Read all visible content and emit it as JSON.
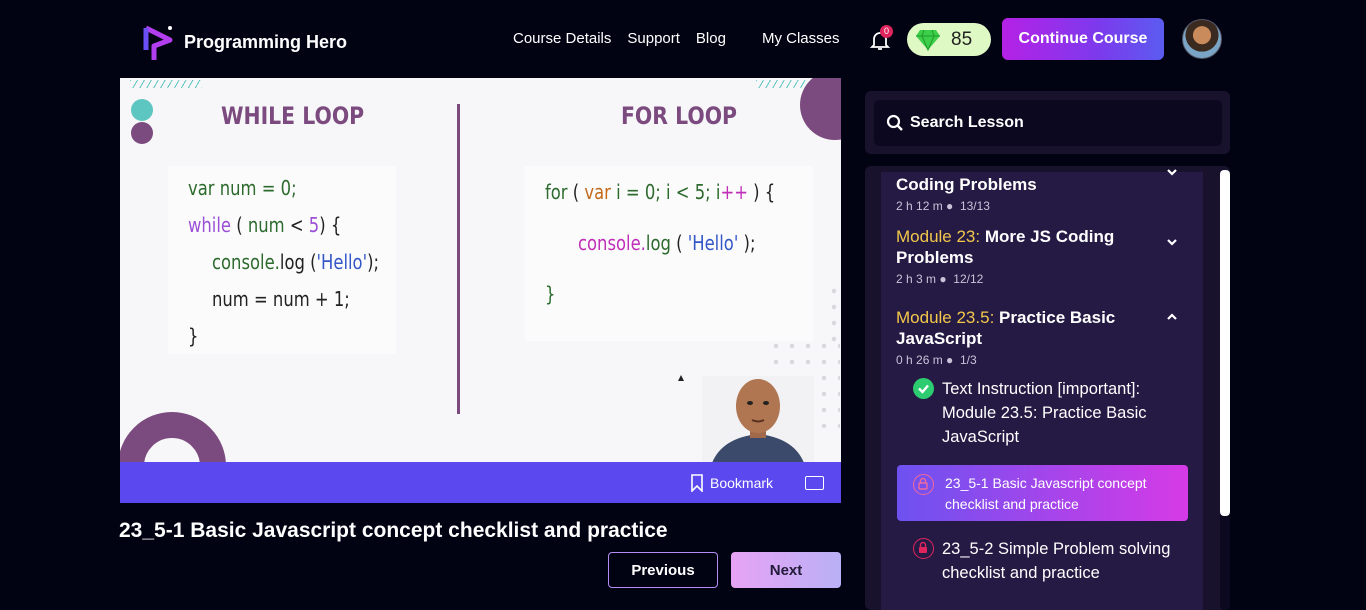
{
  "header": {
    "brand": "Programming Hero",
    "nav": [
      "Course Details",
      "Support",
      "Blog",
      "My Classes"
    ],
    "notification_count": "0",
    "gems": "85",
    "continue_label": "Continue Course"
  },
  "slide": {
    "left_title": "WHILE LOOP",
    "right_title": "FOR LOOP"
  },
  "player": {
    "bookmark_label": "Bookmark"
  },
  "lesson": {
    "title": "23_5-1 Basic Javascript concept checklist and practice",
    "prev_label": "Previous",
    "next_label": "Next"
  },
  "sidebar": {
    "search_placeholder": "Search Lesson",
    "modules": [
      {
        "prefix": "",
        "title": "Coding Problems",
        "duration": "2 h 12 m",
        "progress": "13/13",
        "expanded": false
      },
      {
        "prefix": "Module 23:",
        "title": " More JS Coding Problems",
        "duration": "2 h 3 m",
        "progress": "12/12",
        "expanded": false
      },
      {
        "prefix": "Module 23.5:",
        "title": " Practice Basic JavaScript",
        "duration": "0 h 26 m",
        "progress": "1/3",
        "expanded": true
      }
    ],
    "lessons": [
      {
        "label": "Text Instruction [important]: Module 23.5: Practice Basic JavaScript",
        "status": "completed"
      },
      {
        "label": "23_5-1 Basic Javascript concept checklist and practice",
        "status": "active"
      },
      {
        "label": "23_5-2 Simple Problem solving checklist and practice",
        "status": "locked"
      }
    ]
  },
  "colors": {
    "accent_purple": "#5b48ee",
    "gradient_start": "#b521e6",
    "module_prefix": "#f2c84b",
    "background": "#010313"
  }
}
